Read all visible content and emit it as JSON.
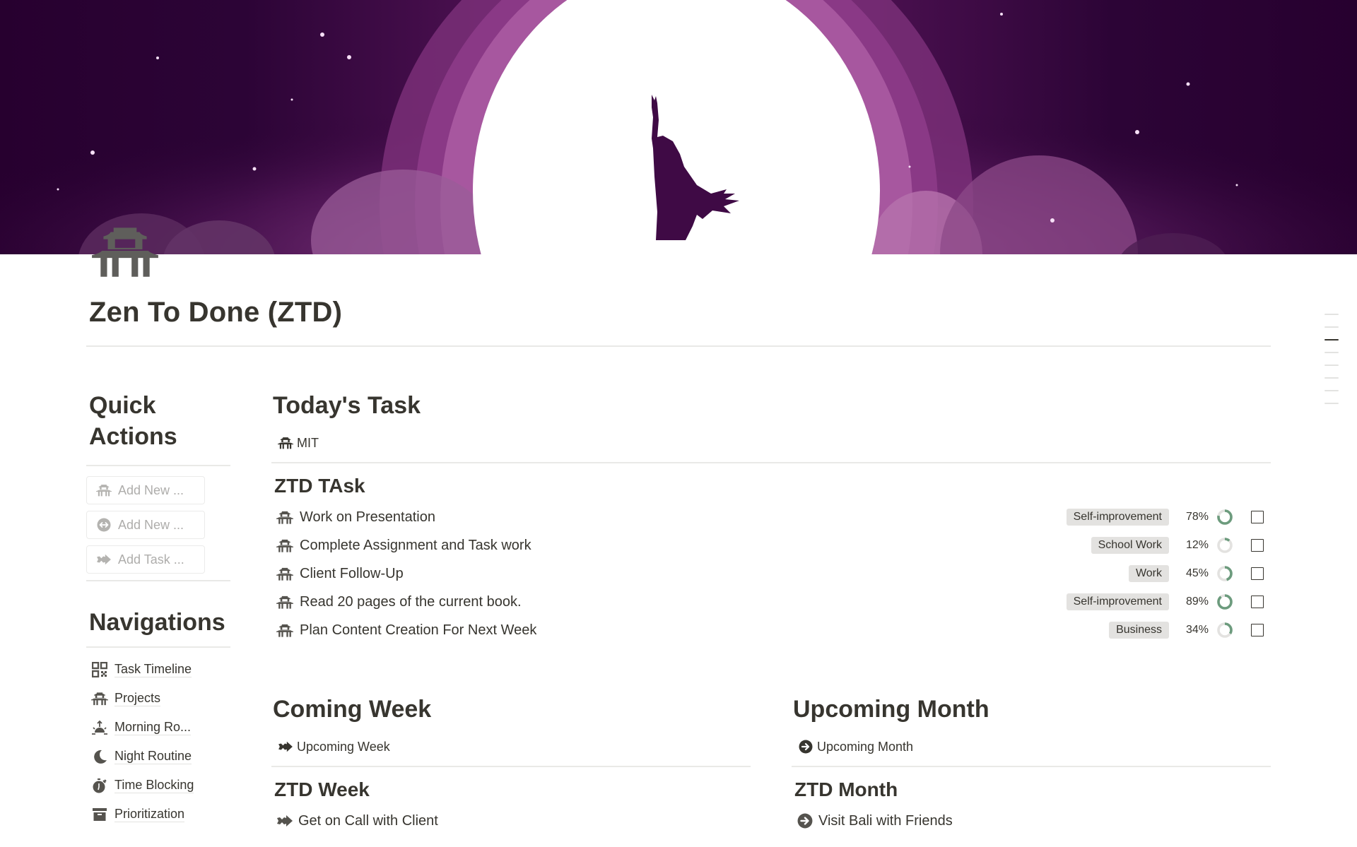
{
  "cover": {
    "description": "Night sky with moon and silhouette of a woman raising her arm",
    "colors": {
      "sky_dark": "#27002f",
      "glow": "#a4589f",
      "moon": "#ffffff",
      "silhouette": "#3f0a45"
    }
  },
  "page": {
    "icon": "pagoda-gate-icon",
    "title": "Zen To Done (ZTD)"
  },
  "toc": {
    "items": 8,
    "active_index": 2
  },
  "sidebar": {
    "quick_actions": {
      "heading_line1": "Quick",
      "heading_line2": "Actions",
      "buttons": [
        {
          "label": "Add New ...",
          "icon": "pagoda-gate-icon"
        },
        {
          "label": "Add New ...",
          "icon": "circle-double-arrow-icon"
        },
        {
          "label": "Add Task ...",
          "icon": "arrow-right-icon"
        }
      ]
    },
    "navigations": {
      "heading": "Navigations",
      "items": [
        {
          "label": "Task Timeline",
          "icon": "qr-grid-icon"
        },
        {
          "label": "Projects",
          "icon": "pagoda-gate-icon"
        },
        {
          "label": "Morning Ro...",
          "icon": "sunrise-icon"
        },
        {
          "label": "Night Routine",
          "icon": "moon-icon"
        },
        {
          "label": "Time Blocking",
          "icon": "stopwatch-icon"
        },
        {
          "label": "Prioritization",
          "icon": "archive-box-icon"
        }
      ]
    }
  },
  "today": {
    "heading": "Today's Task",
    "view_tab": {
      "label": "MIT",
      "icon": "pagoda-gate-icon"
    },
    "database_title": "ZTD TAsk",
    "progress_color": "#6c9b7d",
    "tasks": [
      {
        "name": "Work on Presentation",
        "tag": "Self-improvement",
        "progress": 78,
        "progress_label": "78%",
        "done": false
      },
      {
        "name": "Complete Assignment and Task work",
        "tag": "School Work",
        "progress": 12,
        "progress_label": "12%",
        "done": false
      },
      {
        "name": "Client Follow-Up",
        "tag": "Work",
        "progress": 45,
        "progress_label": "45%",
        "done": false
      },
      {
        "name": "Read 20 pages of the current book.",
        "tag": "Self-improvement",
        "progress": 89,
        "progress_label": "89%",
        "done": false
      },
      {
        "name": "Plan Content Creation For Next Week",
        "tag": "Business",
        "progress": 34,
        "progress_label": "34%",
        "done": false
      }
    ]
  },
  "coming_week": {
    "heading": "Coming Week",
    "view_tab": {
      "label": "Upcoming Week",
      "icon": "arrow-right-icon"
    },
    "database_title": "ZTD Week",
    "items": [
      {
        "name": "Get on Call with Client",
        "icon": "arrow-right-icon"
      }
    ]
  },
  "upcoming_month": {
    "heading": "Upcoming Month",
    "view_tab": {
      "label": "Upcoming Month",
      "icon": "circle-arrow-right-icon"
    },
    "database_title": "ZTD Month",
    "items": [
      {
        "name": "Visit Bali with Friends",
        "icon": "circle-arrow-right-icon"
      }
    ]
  }
}
